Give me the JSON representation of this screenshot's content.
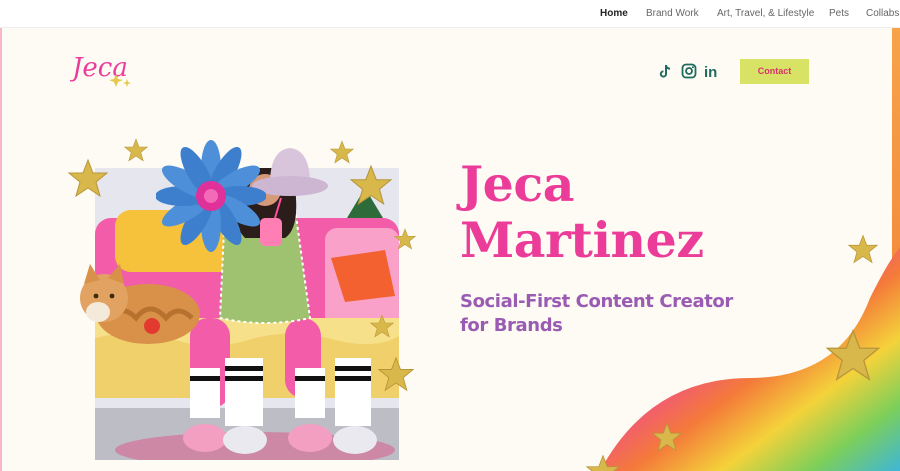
{
  "nav": {
    "items": [
      {
        "label": "Home",
        "active": true
      },
      {
        "label": "Brand Work",
        "active": false
      },
      {
        "label": "Art, Travel, & Lifestyle",
        "active": false
      },
      {
        "label": "Pets",
        "active": false
      },
      {
        "label": "Collabs",
        "active": false
      }
    ]
  },
  "header": {
    "logo_text": "Jeca",
    "social_icons": [
      "tiktok-icon",
      "instagram-icon",
      "linkedin-icon"
    ],
    "linkedin_glyph": "in",
    "contact_label": "Contact"
  },
  "hero": {
    "title_line1": "Jeca",
    "title_line2": "Martinez",
    "subtitle_line1": "Social-First Content Creator",
    "subtitle_line2": "for Brands"
  },
  "colors": {
    "accent_pink": "#ec3c9a",
    "subtitle_purple": "#9a5bb3",
    "contact_button": "#d8e264",
    "background": "#fdfbf3",
    "star_gold": "#d8b84a"
  }
}
